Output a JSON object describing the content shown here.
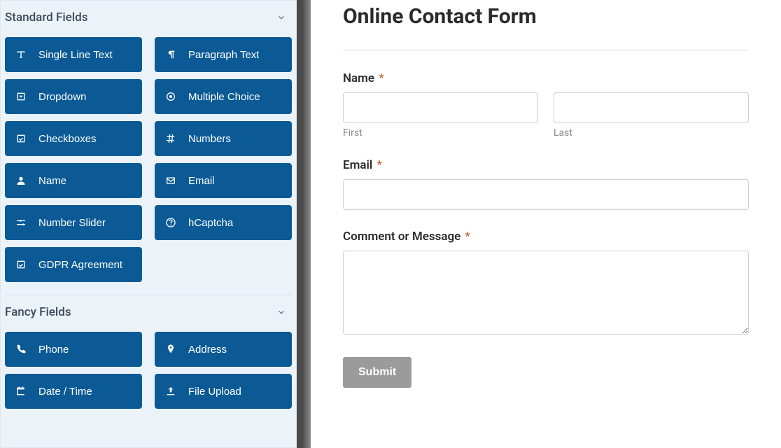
{
  "sidebar": {
    "sections": [
      {
        "title": "Standard Fields",
        "fields": [
          {
            "icon": "text",
            "label": "Single Line Text"
          },
          {
            "icon": "paragraph",
            "label": "Paragraph Text"
          },
          {
            "icon": "dropdown",
            "label": "Dropdown"
          },
          {
            "icon": "radio",
            "label": "Multiple Choice"
          },
          {
            "icon": "check",
            "label": "Checkboxes"
          },
          {
            "icon": "hash",
            "label": "Numbers"
          },
          {
            "icon": "user",
            "label": "Name"
          },
          {
            "icon": "envelope",
            "label": "Email"
          },
          {
            "icon": "slider",
            "label": "Number Slider"
          },
          {
            "icon": "question",
            "label": "hCaptcha"
          },
          {
            "icon": "check",
            "label": "GDPR Agreement"
          }
        ]
      },
      {
        "title": "Fancy Fields",
        "fields": [
          {
            "icon": "phone",
            "label": "Phone"
          },
          {
            "icon": "pin",
            "label": "Address"
          },
          {
            "icon": "calendar",
            "label": "Date / Time"
          },
          {
            "icon": "upload",
            "label": "File Upload"
          }
        ]
      }
    ]
  },
  "form": {
    "title": "Online Contact Form",
    "name_label": "Name",
    "name_first_sub": "First",
    "name_last_sub": "Last",
    "email_label": "Email",
    "message_label": "Comment or Message",
    "submit_label": "Submit",
    "required_mark": "*"
  }
}
